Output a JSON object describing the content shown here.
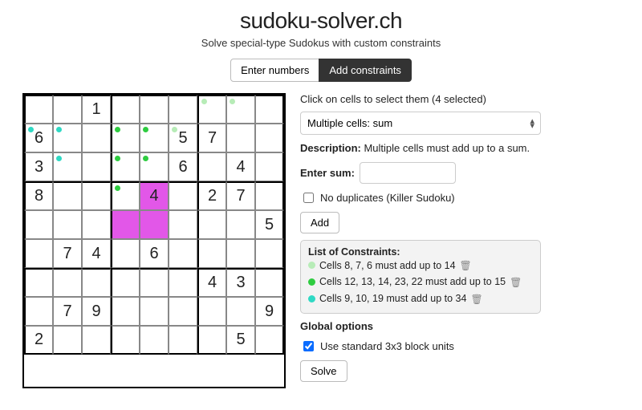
{
  "header": {
    "title": "sudoku-solver.ch",
    "subtitle": "Solve special-type Sudokus with custom constraints"
  },
  "tabs": {
    "enter": "Enter numbers",
    "constraints": "Add constraints"
  },
  "board": {
    "cells": {
      "r0c2": "1",
      "r1c0": "6",
      "r1c5": "5",
      "r1c6": "7",
      "r2c0": "3",
      "r2c5": "6",
      "r2c7": "4",
      "r3c0": "8",
      "r3c4": "4",
      "r3c6": "2",
      "r3c7": "7",
      "r4c8": "5",
      "r5c1": "7",
      "r5c2": "4",
      "r5c4": "6",
      "r6c6": "4",
      "r6c7": "3",
      "r7c1": "7",
      "r7c2": "9",
      "r7c8": "9",
      "r8c0": "2",
      "r8c7": "5"
    },
    "selected": [
      "r3c4",
      "r4c3",
      "r4c4"
    ],
    "dots": {
      "c0": [
        "r0c6",
        "r0c7",
        "r1c5"
      ],
      "c1": [
        "r1c3",
        "r1c4",
        "r2c3",
        "r2c4",
        "r3c3"
      ],
      "c2": [
        "r1c0",
        "r1c1",
        "r2c1"
      ]
    }
  },
  "panel": {
    "hint": "Click on cells to select them (4 selected)",
    "select_value": "Multiple cells: sum",
    "desc_label": "Description:",
    "desc_text": "Multiple cells must add up to a sum.",
    "enter_sum_label": "Enter sum:",
    "no_dup_label": "No duplicates (Killer Sudoku)",
    "add_label": "Add",
    "constraints_title": "List of Constraints:",
    "constraints": [
      {
        "color": "c0",
        "text": "Cells 8, 7, 6 must add up to 14"
      },
      {
        "color": "c1",
        "text": "Cells 12, 13, 14, 23, 22 must add up to 15"
      },
      {
        "color": "c2",
        "text": "Cells 9, 10, 19 must add up to 34"
      }
    ],
    "global_title": "Global options",
    "global_chk": "Use standard 3x3 block units",
    "solve_label": "Solve"
  }
}
